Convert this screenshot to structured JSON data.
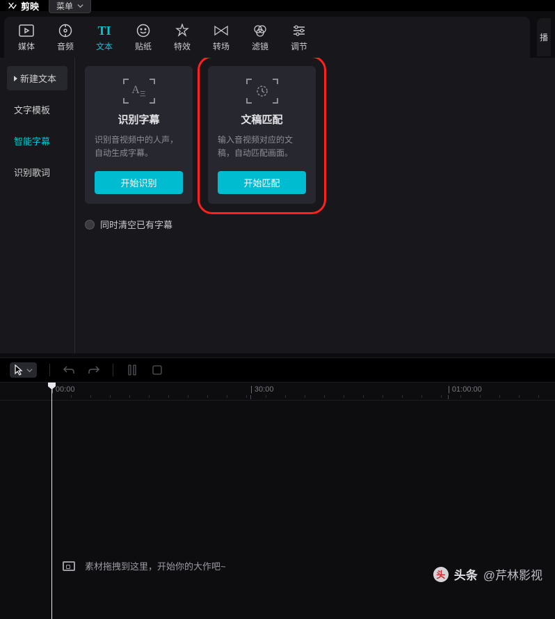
{
  "topbar": {
    "app_name": "剪映",
    "menu_label": "菜单"
  },
  "tabs": [
    {
      "label": "媒体"
    },
    {
      "label": "音频"
    },
    {
      "label": "文本"
    },
    {
      "label": "贴纸"
    },
    {
      "label": "特效"
    },
    {
      "label": "转场"
    },
    {
      "label": "滤镜"
    },
    {
      "label": "调节"
    }
  ],
  "right_stub_label": "播",
  "sidebar": {
    "items": [
      {
        "label": "新建文本"
      },
      {
        "label": "文字模板"
      },
      {
        "label": "智能字幕"
      },
      {
        "label": "识别歌词"
      }
    ]
  },
  "cards": [
    {
      "title": "识别字幕",
      "desc": "识别音视频中的人声，自动生成字幕。",
      "button": "开始识别"
    },
    {
      "title": "文稿匹配",
      "desc": "输入音视频对应的文稿，自动匹配画面。",
      "button": "开始匹配"
    }
  ],
  "check_label": "同时清空已有字幕",
  "timeline": {
    "ticks": [
      {
        "pos": 74,
        "label": "00:00"
      },
      {
        "pos": 360,
        "label": "30:00"
      },
      {
        "pos": 644,
        "label": "01:00:00"
      }
    ],
    "drop_hint": "素材拖拽到这里，开始你的大作吧~"
  },
  "watermark": {
    "brand": "头条",
    "author": "@芹林影视"
  }
}
